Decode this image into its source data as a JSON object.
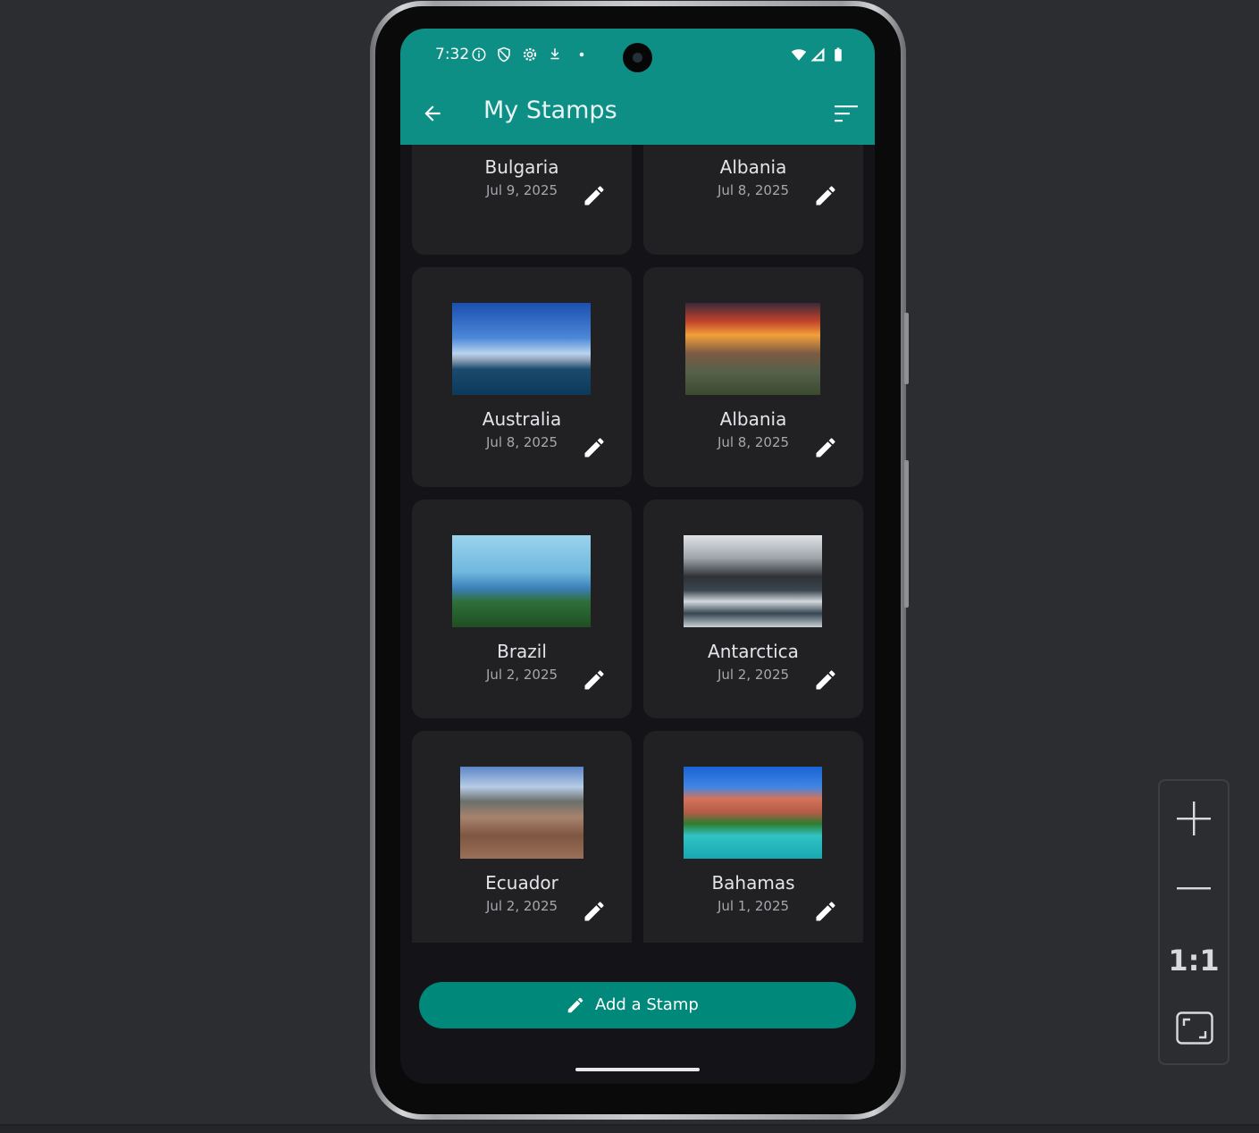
{
  "status_bar": {
    "time": "7:32",
    "icons": [
      "info-icon",
      "shield-icon",
      "settings-icon",
      "download-icon",
      "dot-icon",
      "wifi-icon",
      "signal-icon",
      "battery-icon"
    ]
  },
  "app_bar": {
    "title": "My Stamps",
    "back_icon": "arrow-back-icon",
    "sort_icon": "sort-icon",
    "color": "#0e8f86"
  },
  "stamps": [
    {
      "country": "Bulgaria",
      "date": "Jul 9, 2025"
    },
    {
      "country": "Albania",
      "date": "Jul 8, 2025"
    },
    {
      "country": "Australia",
      "date": "Jul 8, 2025"
    },
    {
      "country": "Albania",
      "date": "Jul 8, 2025"
    },
    {
      "country": "Brazil",
      "date": "Jul 2, 2025"
    },
    {
      "country": "Antarctica",
      "date": "Jul 2, 2025"
    },
    {
      "country": "Ecuador",
      "date": "Jul 2, 2025"
    },
    {
      "country": "Bahamas",
      "date": "Jul 1, 2025"
    }
  ],
  "fab": {
    "label": "Add a Stamp",
    "icon": "pencil-icon",
    "color": "#00897b"
  },
  "zoom_controls": {
    "zoom_in_icon": "plus-icon",
    "zoom_out_icon": "minus-icon",
    "actual_size_label": "1:1",
    "fit_icon": "fit-screen-icon"
  }
}
